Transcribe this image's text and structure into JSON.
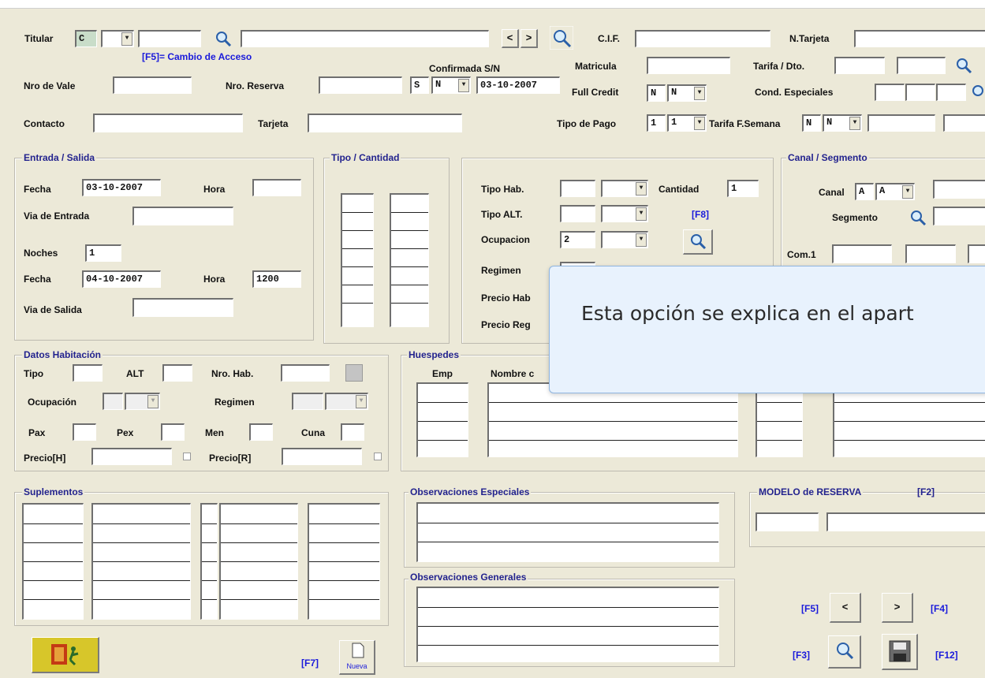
{
  "header": {
    "titular_label": "Titular",
    "titular_code": "C",
    "f5_hint": "[F5]= Cambio de Acceso",
    "nav_prev": "<",
    "nav_next": ">",
    "cif_label": "C.I.F.",
    "ntarjeta_label": "N.Tarjeta",
    "nro_vale_label": "Nro de Vale",
    "nro_reserva_label": "Nro. Reserva",
    "confirmada_label": "Confirmada S/N",
    "confirmada_code": "S",
    "confirmada_value": "N",
    "confirmada_date": "03-10-2007",
    "matricula_label": "Matricula",
    "tarifa_dto_label": "Tarifa / Dto.",
    "full_credit_label": "Full Credit",
    "full_credit_code": "N",
    "full_credit_value": "N",
    "cond_especiales_label": "Cond. Especiales",
    "contacto_label": "Contacto",
    "tarjeta_label": "Tarjeta",
    "tipo_pago_label": "Tipo de Pago",
    "tipo_pago_code": "1",
    "tipo_pago_value": "1",
    "tarifa_fsemana_label": "Tarifa F.Semana",
    "tarifa_fsemana_code": "N",
    "tarifa_fsemana_value": "N"
  },
  "entrada_salida": {
    "title": "Entrada / Salida",
    "fecha_label": "Fecha",
    "fecha_entrada": "03-10-2007",
    "hora_label": "Hora",
    "via_entrada_label": "Via de Entrada",
    "noches_label": "Noches",
    "noches_value": "1",
    "fecha_salida": "04-10-2007",
    "hora_salida": "1200",
    "via_salida_label": "Via de Salida"
  },
  "tipo_cantidad": {
    "title": "Tipo / Cantidad"
  },
  "habitacion_sel": {
    "tipo_hab_label": "Tipo Hab.",
    "cantidad_label": "Cantidad",
    "cantidad_value": "1",
    "tipo_alt_label": "Tipo ALT.",
    "f8_label": "[F8]",
    "ocupacion_label": "Ocupacion",
    "ocupacion_value": "2",
    "regimen_label": "Regimen",
    "precio_hab_label": "Precio Hab",
    "precio_reg_label": "Precio Reg"
  },
  "canal_segmento": {
    "title": "Canal / Segmento",
    "canal_label": "Canal",
    "canal_code": "A",
    "canal_value": "A",
    "segmento_label": "Segmento",
    "com1_label": "Com.1"
  },
  "datos_habitacion": {
    "title": "Datos Habitación",
    "tipo_label": "Tipo",
    "alt_label": "ALT",
    "nro_hab_label": "Nro. Hab.",
    "ocupacion_label": "Ocupación",
    "regimen_label": "Regimen",
    "pax_label": "Pax",
    "pex_label": "Pex",
    "men_label": "Men",
    "cuna_label": "Cuna",
    "precio_h_label": "Precio[H]",
    "precio_r_label": "Precio[R]"
  },
  "huespedes": {
    "title": "Huespedes",
    "emp_label": "Emp",
    "nombre_label": "Nombre c"
  },
  "suplementos": {
    "title": "Suplementos"
  },
  "observaciones": {
    "especiales_title": "Observaciones Especiales",
    "generales_title": "Observaciones Generales"
  },
  "modelo": {
    "title": "MODELO de RESERVA",
    "key": "[F2]"
  },
  "footer": {
    "f7_label": "[F7]",
    "nueva_label": "Nueva",
    "f5_label": "[F5]",
    "prev_label": "<",
    "next_label": ">",
    "f4_label": "[F4]",
    "f3_label": "[F3]",
    "f12_label": "[F12]"
  },
  "tooltip": {
    "text": "Esta opción se explica en el apart"
  },
  "colors": {
    "background": "#ece9d8",
    "group_title": "#23238e",
    "hint_blue": "#1a1adb",
    "tooltip_bg": "#e8f2fd"
  }
}
